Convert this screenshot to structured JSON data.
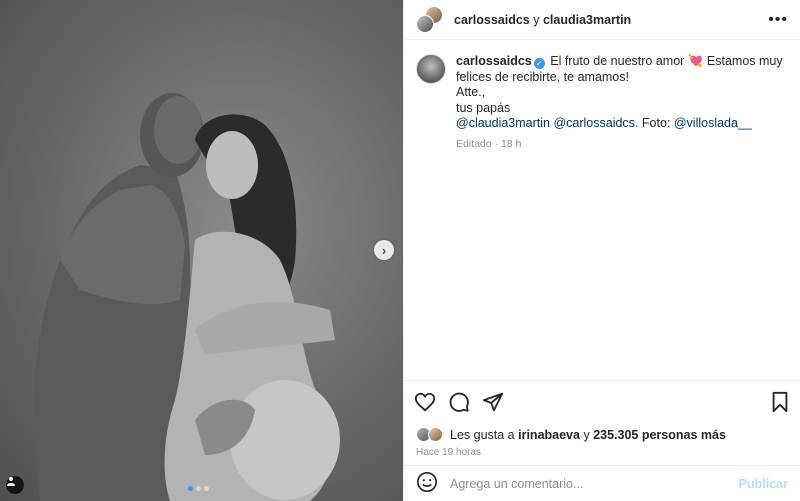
{
  "post": {
    "photo_description_icon": "photo",
    "carousel": {
      "dots": 3,
      "active_index": 0,
      "next_icon": "chevron-right-icon"
    }
  },
  "header": {
    "user1": "carlossaidcs",
    "joiner": "y",
    "user2": "claudia3martin",
    "more_icon": "ellipsis-icon"
  },
  "caption": {
    "username": "carlossaidcs",
    "text_1": "El fruto de nuestro amor",
    "heart_emoji": "💘",
    "text_2": "Estamos muy felices de recibirte, te amamos!",
    "line_atte": "Atte.,",
    "line_papas": "tus papás",
    "mention_1": "@claudia3martin",
    "mention_2": "@carlossaidcs",
    "foto_label": ". Foto:",
    "mention_3": "@villoslada__",
    "edited": "Editado",
    "dot": "·",
    "age": "18 h"
  },
  "likes": {
    "prefix": "Les gusta a",
    "user": "irinabaeva",
    "and": "y",
    "count": "235.305 personas más"
  },
  "timestamp": "Hace 19 horas",
  "comment": {
    "placeholder": "Agrega un comentario...",
    "publish": "Publicar"
  },
  "colors": {
    "accent": "#3897f0",
    "publish_disabled": "#b2dffc",
    "link": "#00376b"
  }
}
